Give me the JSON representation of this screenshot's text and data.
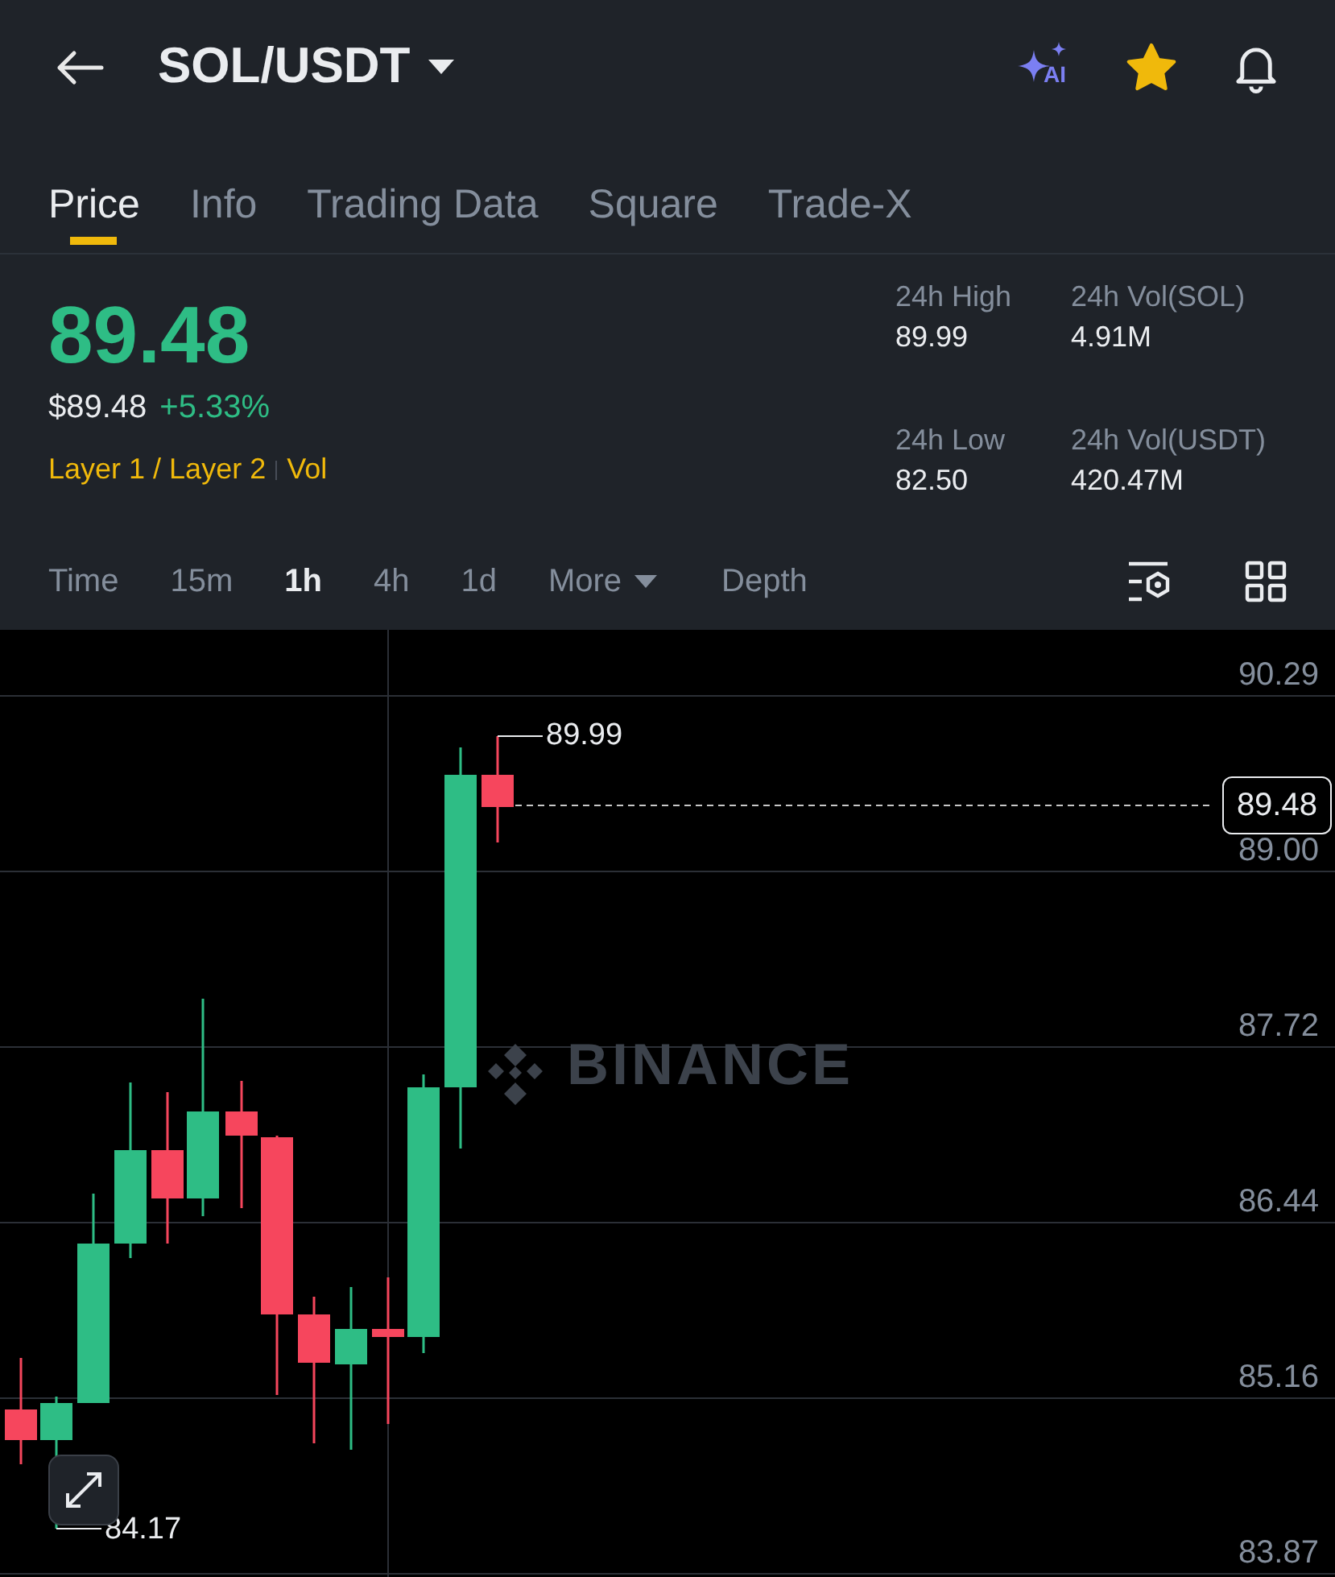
{
  "header": {
    "pair": "SOL/USDT",
    "ai_badge": "AI",
    "favorited": true
  },
  "tabs": [
    {
      "label": "Price",
      "selected": true
    },
    {
      "label": "Info",
      "selected": false
    },
    {
      "label": "Trading Data",
      "selected": false
    },
    {
      "label": "Square",
      "selected": false
    },
    {
      "label": "Trade-X",
      "selected": false
    }
  ],
  "price": {
    "last": "89.48",
    "usd": "$89.48",
    "change": "+5.33%",
    "tags": [
      "Layer 1 / Layer 2",
      "Vol"
    ]
  },
  "stats": [
    {
      "label": "24h High",
      "value": "89.99"
    },
    {
      "label": "24h Vol(SOL)",
      "value": "4.91M"
    },
    {
      "label": "24h Low",
      "value": "82.50"
    },
    {
      "label": "24h Vol(USDT)",
      "value": "420.47M"
    }
  ],
  "intervals": [
    {
      "label": "Time",
      "selected": false,
      "kind": "plain"
    },
    {
      "label": "15m",
      "selected": false,
      "kind": "plain"
    },
    {
      "label": "1h",
      "selected": true,
      "kind": "plain"
    },
    {
      "label": "4h",
      "selected": false,
      "kind": "plain"
    },
    {
      "label": "1d",
      "selected": false,
      "kind": "plain"
    },
    {
      "label": "More",
      "selected": false,
      "kind": "dropdown"
    },
    {
      "label": "Depth",
      "selected": false,
      "kind": "plain"
    }
  ],
  "chart": {
    "axis_labels": [
      "90.29",
      "89.00",
      "87.72",
      "86.44",
      "85.16",
      "83.87"
    ],
    "high_label": "89.99",
    "low_label": "84.17",
    "last_price_tag": "89.48",
    "brand_mark": "BINANCE"
  }
}
